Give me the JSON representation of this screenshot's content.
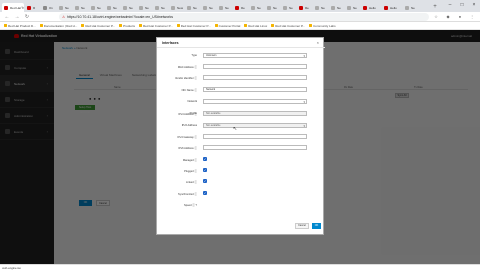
{
  "browser": {
    "tabs": [
      {
        "title": "Red Hat V"
      },
      {
        "title": "R"
      },
      {
        "title": "Ov"
      },
      {
        "title": "Ne"
      },
      {
        "title": "Ne"
      },
      {
        "title": "Ne"
      },
      {
        "title": "Ne"
      },
      {
        "title": "Ne"
      },
      {
        "title": "Ne"
      },
      {
        "title": "Ne"
      },
      {
        "title": "New"
      },
      {
        "title": "Ne"
      },
      {
        "title": "Ne"
      },
      {
        "title": "Ne"
      },
      {
        "title": "Re"
      },
      {
        "title": "Ne"
      },
      {
        "title": "Ne"
      },
      {
        "title": "Ne"
      },
      {
        "title": "Re"
      },
      {
        "title": "Ne"
      },
      {
        "title": "Ne"
      },
      {
        "title": "Ne"
      },
      {
        "title": "Hello"
      },
      {
        "title": "Hello"
      },
      {
        "title": "Ne"
      }
    ],
    "url": "https://10.70.41.18/ovirt-engine/webadmin/?locale=en_US#networks",
    "bookmarks": [
      "Red Hat Product D...",
      "Documentation | Red H...",
      "Red Hat Customer P...",
      "Products",
      "Red Hat Customer P...",
      "Red Hat Customer P...",
      "Customer Portal",
      "Red Hat Linux",
      "Red Hat Customer P...",
      "Community Labs"
    ],
    "window": {
      "minimize": "–",
      "maximize": "□",
      "close": "×"
    },
    "new_tab": "+"
  },
  "app": {
    "product": "Red Hat Virtualization",
    "user": "admin@internal",
    "sidebar": [
      "Dashboard",
      "Compute",
      "Network",
      "Storage",
      "Administration",
      "Events"
    ],
    "breadcrumb": {
      "root": "Network",
      "sep": "»",
      "current": "Network"
    },
    "page_tabs": [
      "General",
      "Virtual Machines",
      "Networking Labels"
    ],
    "table_cols": [
      "Name",
      "Network Label",
      "Speed",
      "Rx Rate",
      "Tx Rate"
    ],
    "green_btn": "Setup Host Networks",
    "right_btn": "Sync All",
    "bottom_btns": [
      "OK",
      "Cancel"
    ],
    "dots": "● ● ●"
  },
  "modal": {
    "title": "Interfaces",
    "close": "×",
    "fields": [
      {
        "label": "Type",
        "value": "Unknown",
        "kind": "select"
      },
      {
        "label": "MAC Address ⓘ",
        "value": "",
        "kind": "input"
      },
      {
        "label": "Vendor identifier ⓘ",
        "value": "",
        "kind": "input"
      },
      {
        "label": "NIC Name ⓘ",
        "value": "Network",
        "kind": "input"
      },
      {
        "label": "Network",
        "value": "",
        "kind": "input"
      },
      {
        "label": "Profile",
        "value": "",
        "kind": "select"
      },
      {
        "label": "IPv4 Address ⓘ",
        "value": "Not available",
        "kind": "disabled"
      },
      {
        "label": "IPv6 Address",
        "value": "Not available",
        "kind": "select"
      },
      {
        "label": "IPv4 Gateway ⓘ",
        "value": "",
        "kind": "input"
      },
      {
        "label": "IPv6 Address ⓘ",
        "value": "",
        "kind": "input"
      }
    ],
    "checks": [
      {
        "label": "Managed ⓘ"
      },
      {
        "label": "Plugged ⓘ"
      },
      {
        "label": "Linked ⓘ"
      },
      {
        "label": "Synchronized ⓘ"
      }
    ],
    "speed": "Speed ⓘ  ?",
    "cancel": "Cancel",
    "ok": "OK",
    "check_mark": "✓"
  },
  "download": {
    "file": "ovirt-engine.iso"
  }
}
